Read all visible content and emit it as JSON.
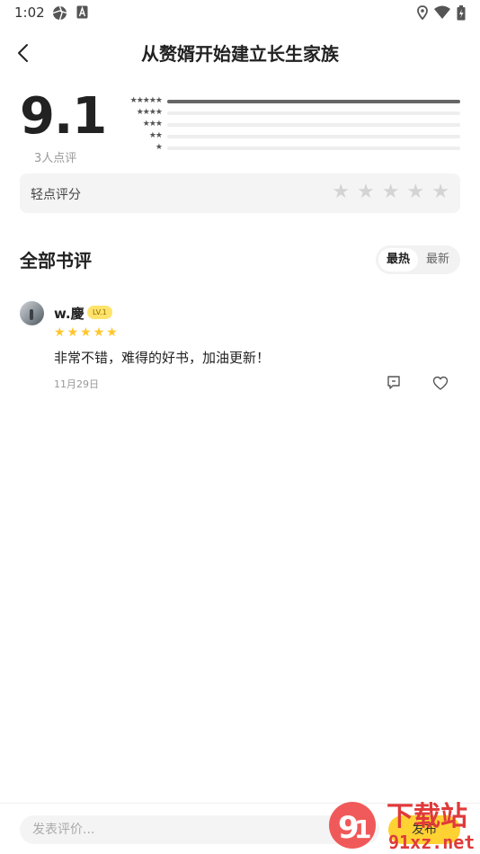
{
  "status_bar": {
    "time": "1:02"
  },
  "header": {
    "title": "从赘婿开始建立长生家族"
  },
  "rating": {
    "score": "9.1",
    "count_label": "3人点评",
    "distribution": [
      {
        "stars": "★★★★★",
        "fraction": 1.0
      },
      {
        "stars": "★★★★",
        "fraction": 0
      },
      {
        "stars": "★★★",
        "fraction": 0
      },
      {
        "stars": "★★",
        "fraction": 0
      },
      {
        "stars": "★",
        "fraction": 0
      }
    ]
  },
  "rate_box": {
    "label": "轻点评分",
    "star_icon": "★"
  },
  "reviews_section": {
    "title": "全部书评",
    "sort_options": [
      "最热",
      "最新"
    ],
    "active_sort": "最热"
  },
  "reviews": [
    {
      "username": "w.慶",
      "level": "LV.1",
      "rating": 5,
      "text": "非常不错，难得的好书，加油更新！",
      "date": "11月29日"
    }
  ],
  "bottom_bar": {
    "input_placeholder": "发表评价...",
    "publish_label": "发布"
  },
  "watermark": {
    "text": "下载站",
    "domain": "91xz.net"
  },
  "colors": {
    "accent_yellow": "#ffd233",
    "star_filled": "#ffc62b",
    "star_empty": "#d4d4d4",
    "level_badge": "#ffe36b"
  }
}
